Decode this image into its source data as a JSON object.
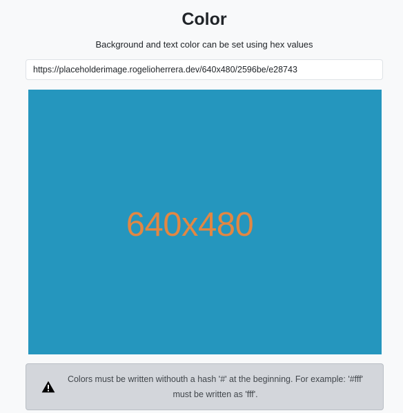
{
  "header": {
    "title": "Color",
    "subtitle": "Background and text color can be set using hex values"
  },
  "url_field": {
    "value": "https://placeholderimage.rogelioherrera.dev/640x480/2596be/e28743"
  },
  "preview": {
    "label": "640x480",
    "background_color": "#2596be",
    "text_color": "#e28743"
  },
  "alert": {
    "icon": "warning-triangle-icon",
    "message": "Colors must be written withouth a hash '#' at the beginning. For example: '#fff' must be written as 'fff'."
  }
}
